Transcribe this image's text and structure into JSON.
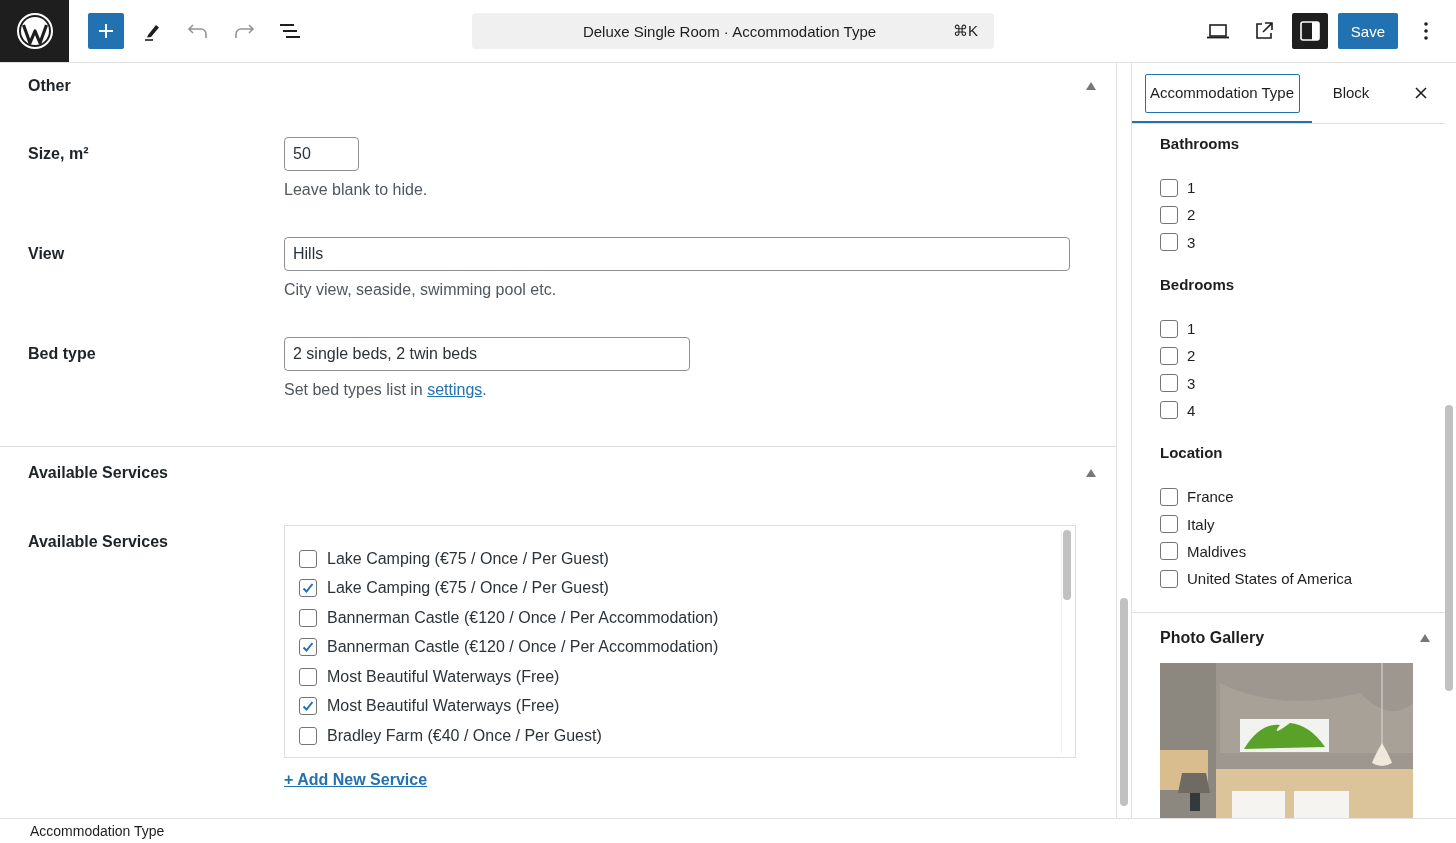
{
  "topbar": {
    "title": "Deluxe Single Room · Accommodation Type",
    "shortcut": "⌘K",
    "save": "Save",
    "sidebar_open": true
  },
  "sections": [
    {
      "title": "Other",
      "expanded": true,
      "fields": [
        {
          "kind": "short",
          "label": "Size, m²",
          "value": "50",
          "hint": "Leave blank to hide."
        },
        {
          "kind": "wide",
          "label": "View",
          "value": "Hills",
          "hint": "City view, seaside, swimming pool etc."
        },
        {
          "kind": "medium",
          "label": "Bed type",
          "value": "2 single beds, 2 twin beds",
          "hint": "Set bed types list in ",
          "hint_link": "settings",
          "hint_end": "."
        }
      ]
    },
    {
      "title": "Available Services",
      "expanded": true,
      "services": {
        "label": "Available Services",
        "add_link": "+ Add New Service",
        "items": [
          {
            "label": "Lake Camping (€75 / Once / Per Guest)",
            "checked": false
          },
          {
            "label": "Lake Camping (€75 / Once / Per Guest)",
            "checked": true
          },
          {
            "label": "Bannerman Castle (€120 / Once / Per Accommodation)",
            "checked": false
          },
          {
            "label": "Bannerman Castle (€120 / Once / Per Accommodation)",
            "checked": true
          },
          {
            "label": "Most Beautiful Waterways (Free)",
            "checked": false
          },
          {
            "label": "Most Beautiful Waterways (Free)",
            "checked": true
          },
          {
            "label": "Bradley Farm (€40 / Once / Per Guest)",
            "checked": false
          }
        ]
      }
    }
  ],
  "sidebar": {
    "tabs": [
      {
        "label": "Accommodation Type",
        "selected": true
      },
      {
        "label": "Block",
        "selected": false
      }
    ],
    "groups": [
      {
        "title": "Bathrooms",
        "options": [
          {
            "label": "1",
            "checked": false
          },
          {
            "label": "2",
            "checked": false
          },
          {
            "label": "3",
            "checked": false
          }
        ]
      },
      {
        "title": "Bedrooms",
        "options": [
          {
            "label": "1",
            "checked": false
          },
          {
            "label": "2",
            "checked": false
          },
          {
            "label": "3",
            "checked": false
          },
          {
            "label": "4",
            "checked": false
          }
        ]
      },
      {
        "title": "Location",
        "options": [
          {
            "label": "France",
            "checked": false
          },
          {
            "label": "Italy",
            "checked": false
          },
          {
            "label": "Maldives",
            "checked": false
          },
          {
            "label": "United States of America",
            "checked": false
          }
        ]
      }
    ],
    "panel": {
      "title": "Photo Gallery",
      "expanded": true
    }
  },
  "footer": {
    "breadcrumb": "Accommodation Type"
  }
}
